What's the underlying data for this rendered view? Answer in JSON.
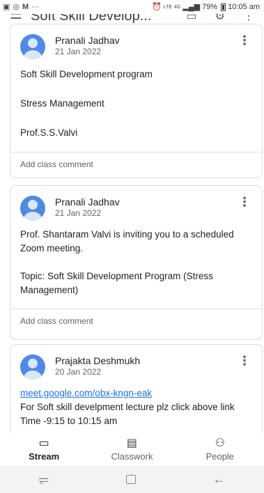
{
  "status_bar": {
    "time": "10:05 am",
    "battery": "79%",
    "network": "4G",
    "left_icons": [
      "image-icon",
      "whatsapp-icon",
      "gmail-icon",
      "more-icon"
    ]
  },
  "app_bar": {
    "title": "Soft Skill Develop..."
  },
  "posts": [
    {
      "author": "Pranali Jadhav",
      "date": "21 Jan 2022",
      "lines": [
        "Soft Skill Development program",
        "Stress Management",
        "Prof.S.S.Valvi"
      ],
      "comment_placeholder": "Add class comment"
    },
    {
      "author": "Pranali Jadhav",
      "date": "21 Jan 2022",
      "lines": [
        "Prof. Shantaram Valvi  is inviting you to a scheduled Zoom meeting.",
        "Topic: Soft Skill Development Program (Stress Management)"
      ],
      "comment_placeholder": "Add class comment"
    },
    {
      "author": "Prajakta Deshmukh",
      "date": "20 Jan 2022",
      "link": "meet.google.com/obx-kngn-eak",
      "lines": [
        "For Soft skill develpment lecture plz click above link",
        "Time -9:15 to 10:15 am"
      ]
    }
  ],
  "bottom_nav": {
    "items": [
      {
        "label": "Stream",
        "icon": "stream-icon",
        "active": true
      },
      {
        "label": "Classwork",
        "icon": "classwork-icon",
        "active": false
      },
      {
        "label": "People",
        "icon": "people-icon",
        "active": false
      }
    ]
  }
}
